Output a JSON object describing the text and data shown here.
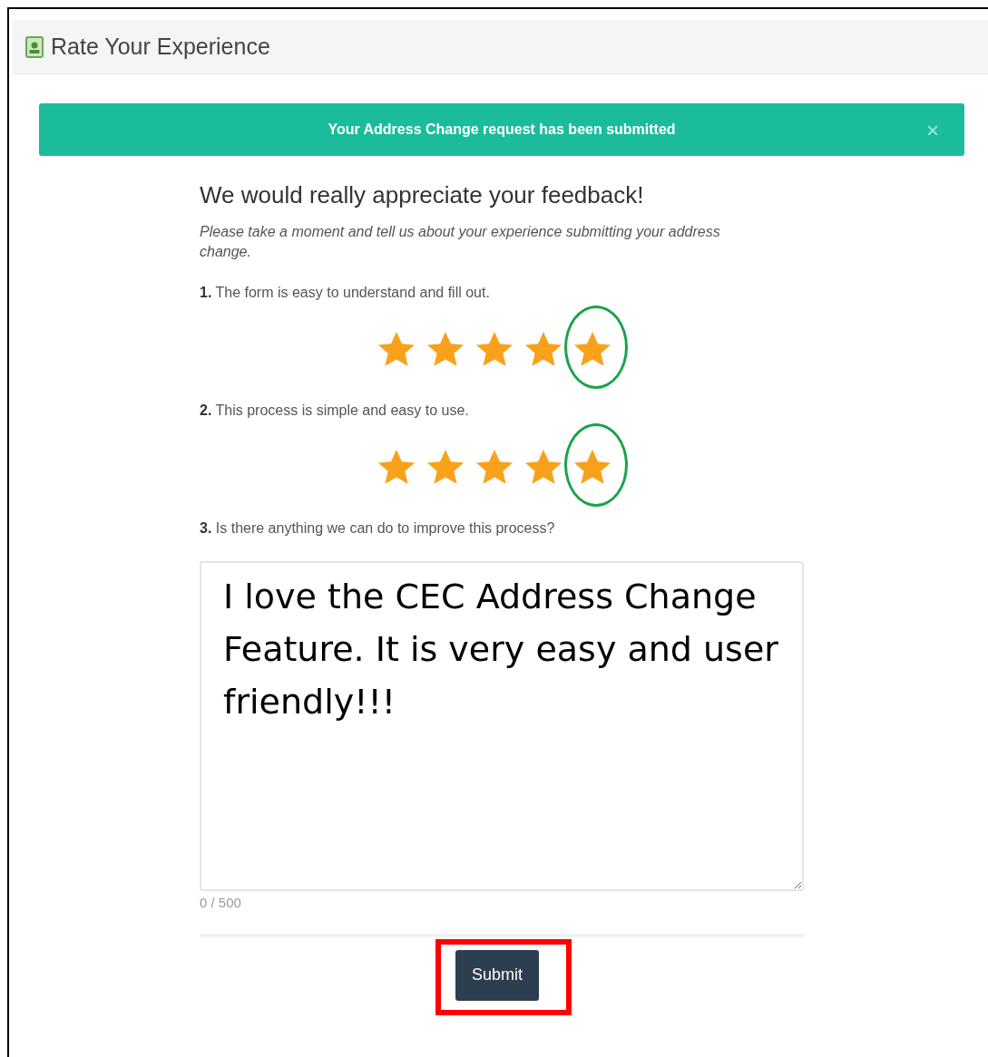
{
  "window": {
    "title": "Rate Your Experience"
  },
  "alert": {
    "message": "Your Address Change request has been submitted",
    "close": "×"
  },
  "heading": "We would really appreciate your feedback!",
  "intro": "Please take a moment and tell us about your experience submitting your address change.",
  "questions": [
    {
      "kind": "rating",
      "number": "1.",
      "text": "The form is easy to understand and fill out.",
      "stars": 5,
      "annotated": true
    },
    {
      "kind": "rating",
      "number": "2.",
      "text": "This process is simple and easy to use.",
      "stars": 5,
      "annotated": true
    },
    {
      "kind": "text",
      "number": "3.",
      "text": "Is there anything we can do to improve this process?",
      "value": "I love the CEC Address Change Feature. It is very easy and user friendly!!!",
      "counter": "0 / 500"
    }
  ],
  "submit": {
    "label": "Submit",
    "annotated": true
  }
}
